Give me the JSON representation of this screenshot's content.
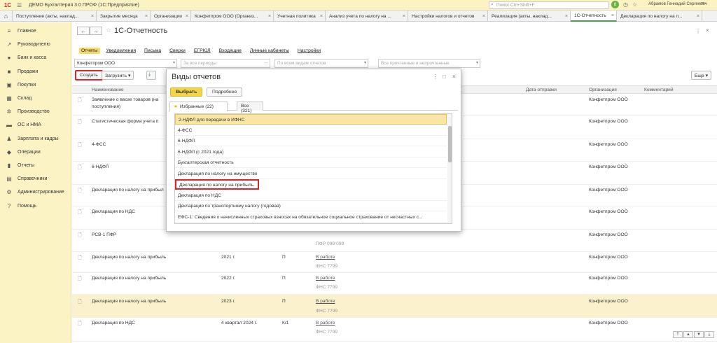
{
  "app": {
    "title": "ДЕМО Бухгалтерия 3.0 ПРОФ  (1С:Предприятие)",
    "logo": "1С",
    "search_placeholder": "Поиск Ctrl+Shift+F",
    "notifications_count": "8",
    "user": "Абрамов Геннадий Сергеевич"
  },
  "tabs": [
    {
      "label": "Поступление (акты, наклад..."
    },
    {
      "label": "Закрытие месяца"
    },
    {
      "label": "Организации"
    },
    {
      "label": "Конфетпром ООО (Организ..."
    },
    {
      "label": "Учетная политика"
    },
    {
      "label": "Анализ учета по налогу на ..."
    },
    {
      "label": "Настройки налогов и отчетов"
    },
    {
      "label": "Реализация (акты, наклад..."
    },
    {
      "label": "1С-Отчетность"
    },
    {
      "label": "Декларация по налогу на п..."
    }
  ],
  "sidebar": {
    "items": [
      {
        "label": "Главное",
        "icon": "menu-icon"
      },
      {
        "label": "Руководителю",
        "icon": "chart-icon"
      },
      {
        "label": "Банк и касса",
        "icon": "bank-icon"
      },
      {
        "label": "Продажи",
        "icon": "sales-icon"
      },
      {
        "label": "Покупки",
        "icon": "purchases-icon"
      },
      {
        "label": "Склад",
        "icon": "warehouse-icon"
      },
      {
        "label": "Производство",
        "icon": "production-icon"
      },
      {
        "label": "ОС и НМА",
        "icon": "assets-icon"
      },
      {
        "label": "Зарплата и кадры",
        "icon": "salary-icon"
      },
      {
        "label": "Операции",
        "icon": "operations-icon"
      },
      {
        "label": "Отчеты",
        "icon": "reports-icon"
      },
      {
        "label": "Справочники",
        "icon": "catalog-icon"
      },
      {
        "label": "Администрирование",
        "icon": "admin-icon"
      },
      {
        "label": "Помощь",
        "icon": "help-icon"
      }
    ]
  },
  "page": {
    "title": "1С-Отчетность",
    "menu": [
      "Отчеты",
      "Уведомления",
      "Письма",
      "Сверки",
      "ЕГРЮЛ",
      "Входящие",
      "Личные кабинеты",
      "Настройки"
    ],
    "filters": {
      "org": "Конфетпром ООО",
      "period_placeholder": "За все периоды",
      "types_placeholder": "По всем видам отчетов",
      "status_placeholder": "Все прочтенные и непрочтенные"
    },
    "toolbar": {
      "create": "Создать",
      "load": "Загрузить",
      "more": "Еще"
    }
  },
  "table": {
    "columns": {
      "name": "Наименование",
      "sent_date": "Дата отправки",
      "org": "Организация",
      "comment": "Комментарий"
    },
    "rows": [
      {
        "name": "Заявление о ввозе товаров (на",
        "name2": "поступления)",
        "period": "",
        "kind": "",
        "status": "",
        "authority": "",
        "org": "Конфетпром ООО"
      },
      {
        "name": "Статистическая форма учета п",
        "name2": "",
        "period": "",
        "kind": "",
        "status": "",
        "authority": "",
        "org": "Конфетпром ООО"
      },
      {
        "name": "4-ФСС",
        "name2": "",
        "period": "",
        "kind": "",
        "status": "",
        "authority": "",
        "org": "Конфетпром ООО"
      },
      {
        "name": "6-НДФЛ",
        "name2": "",
        "period": "",
        "kind": "",
        "status": "",
        "authority": "",
        "org": "Конфетпром ООО"
      },
      {
        "name": "Декларация по налогу на прибыл",
        "name2": "",
        "period": "",
        "kind": "",
        "status": "",
        "authority": "",
        "org": "Конфетпром ООО"
      },
      {
        "name": "Декларация по НДС",
        "name2": "",
        "period": "",
        "kind": "",
        "status": "",
        "authority": "",
        "org": "Конфетпром ООО"
      },
      {
        "name": "РСВ-1 ПФР",
        "name2": "",
        "period": "",
        "kind": "",
        "status": "",
        "authority": "ПФР 099-099",
        "org": "Конфетпром ООО"
      },
      {
        "name": "Декларация по налогу на прибыль",
        "name2": "",
        "period": "2021 г.",
        "kind": "П",
        "status": "В работе",
        "authority": "ФНС 7799",
        "org": "Конфетпром ООО"
      },
      {
        "name": "Декларация по налогу на прибыль",
        "name2": "",
        "period": "2022 г.",
        "kind": "П",
        "status": "В работе",
        "authority": "ФНС 7799",
        "org": "Конфетпром ООО"
      },
      {
        "name": "Декларация по налогу на прибыль",
        "name2": "",
        "period": "2023 г.",
        "kind": "П",
        "status": "В работе",
        "authority": "ФНС 7799",
        "org": "Конфетпром ООО"
      },
      {
        "name": "Декларация по НДС",
        "name2": "",
        "period": "4 квартал 2024 г.",
        "kind": "К/1",
        "status": "В работе",
        "authority": "ФНС 7799",
        "org": "Конфетпром ООО"
      }
    ]
  },
  "modal": {
    "title": "Виды отчетов",
    "select_button": "Выбрать",
    "details_button": "Подробнее",
    "tab_favorites": "Избранные (22)",
    "tab_all": "Все (321)",
    "items": [
      "2-НДФЛ для передачи в ИФНС",
      "4-ФСС",
      "6-НДФЛ",
      "6-НДФЛ (с 2021 года)",
      "Бухгалтерская отчетность",
      "Декларация по налогу на имущество",
      "Декларация по налогу на прибыль",
      "Декларация по НДС",
      "Декларация по транспортному налогу (годовая)",
      "ЕФС-1: Сведения о начисленных страховых взносах на обязательное социальное страхование от несчастных с..."
    ]
  }
}
